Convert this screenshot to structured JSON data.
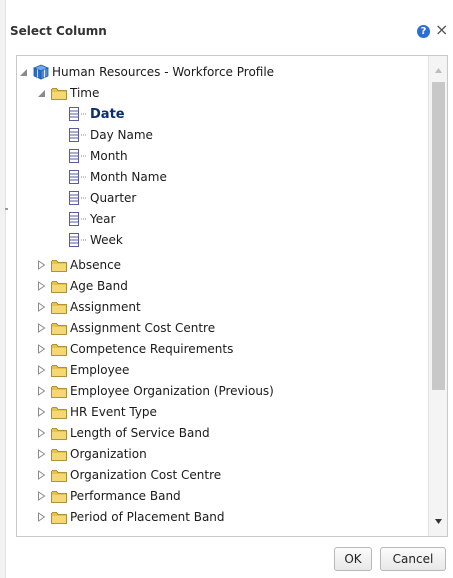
{
  "dialog": {
    "title": "Select Column",
    "help_icon": "help-icon",
    "help_glyph": "?",
    "close_icon": "close-icon",
    "close_glyph": "×"
  },
  "tree": {
    "root": {
      "label": "Human Resources - Workforce Profile",
      "icon": "cube-icon",
      "expanded": true
    },
    "time_folder": {
      "label": "Time",
      "icon": "folder-icon",
      "expanded": true
    },
    "time_columns": [
      "Date",
      "Day Name",
      "Month",
      "Month Name",
      "Quarter",
      "Year",
      "Week"
    ],
    "selected_column": "Date",
    "folders": [
      "Absence",
      "Age Band",
      "Assignment",
      "Assignment Cost Centre",
      "Competence Requirements",
      "Employee",
      "Employee Organization (Previous)",
      "HR Event Type",
      "Length of Service Band",
      "Organization",
      "Organization Cost Centre",
      "Performance Band",
      "Period of Placement Band"
    ]
  },
  "footer": {
    "ok_label": "OK",
    "cancel_label": "Cancel"
  },
  "colors": {
    "folder": "#e8c24a",
    "selected_text": "#0b2d6e",
    "help": "#2c6fd1",
    "cube": "#2a6bc4"
  }
}
